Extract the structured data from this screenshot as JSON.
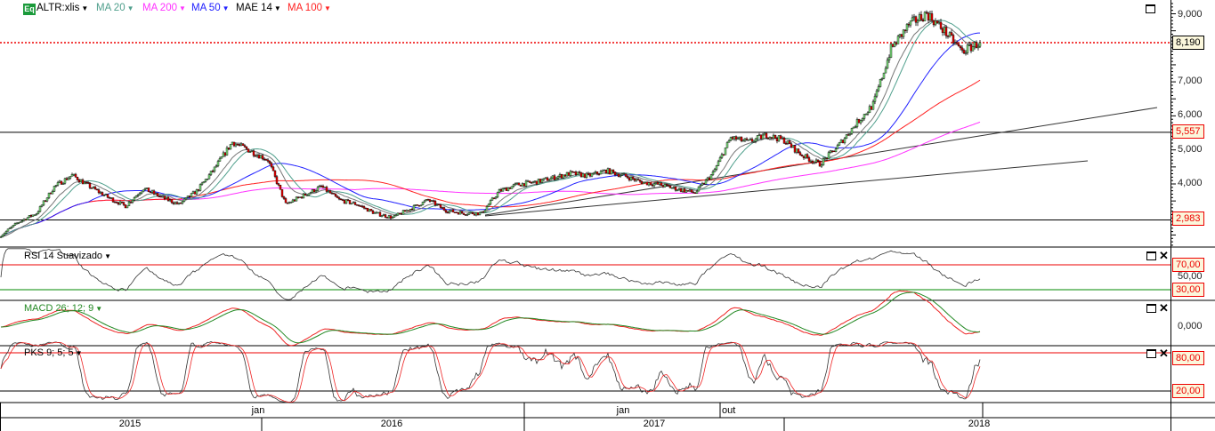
{
  "legend": {
    "symbol_badge": "Eq",
    "symbol": "ALTR:xlis",
    "indicators": [
      {
        "label": "MA 20",
        "color": "#4f9f8c"
      },
      {
        "label": "MA 200",
        "color": "#ff33ff"
      },
      {
        "label": "MA 50",
        "color": "#2222ff"
      },
      {
        "label": "MAE 14",
        "color": "#000000"
      },
      {
        "label": "MA 100",
        "color": "#ff2222"
      }
    ]
  },
  "panels": {
    "rsi": {
      "label": "RSI 14 Suavizado",
      "levels": [
        70,
        30
      ],
      "level_labels": [
        "70,00",
        "50,00",
        "30,00"
      ]
    },
    "macd": {
      "label": "MACD 26; 12; 9",
      "zero_label": "0,000",
      "color": "#228822"
    },
    "pks": {
      "label": "PKS 9; 5; 5",
      "levels": [
        80,
        20
      ],
      "level_labels": [
        "80,00",
        "20,00"
      ]
    }
  },
  "chart_data": {
    "type": "candlestick",
    "price_axis": {
      "ticks": [
        4000,
        5000,
        6000,
        7000,
        8000,
        9000
      ],
      "tick_labels": [
        "4,000",
        "5,000",
        "6,000",
        "7,000",
        "9,000"
      ],
      "range": [
        2400,
        9050
      ]
    },
    "close_anchors": [
      2530,
      2920,
      3180,
      3960,
      4300,
      3960,
      3650,
      3390,
      3910,
      3650,
      3440,
      3830,
      4490,
      5270,
      5010,
      4750,
      3440,
      3700,
      3960,
      3570,
      3440,
      3180,
      3050,
      3310,
      3570,
      3260,
      3180,
      3180,
      3830,
      4020,
      4090,
      4220,
      4350,
      4280,
      4430,
      4280,
      4090,
      4020,
      3890,
      3780,
      4350,
      5400,
      5270,
      5480,
      5320,
      4880,
      4620,
      5140,
      5790,
      6370,
      8010,
      8710,
      9050,
      8530,
      7930,
      8190
    ],
    "last_price": 8190,
    "last_price_label": "8,190",
    "horizontal_lines": [
      {
        "value": 5557,
        "label": "5,557"
      },
      {
        "value": 2983,
        "label": "2,983"
      }
    ],
    "moving_averages": [
      "MA 20",
      "MA 200",
      "MA 50",
      "MAE 14",
      "MA 100"
    ],
    "months": [
      {
        "label": "jan"
      },
      {
        "label": "jan"
      },
      {
        "label": "out"
      }
    ],
    "years": [
      "2015",
      "2016",
      "2017",
      "2018"
    ]
  }
}
